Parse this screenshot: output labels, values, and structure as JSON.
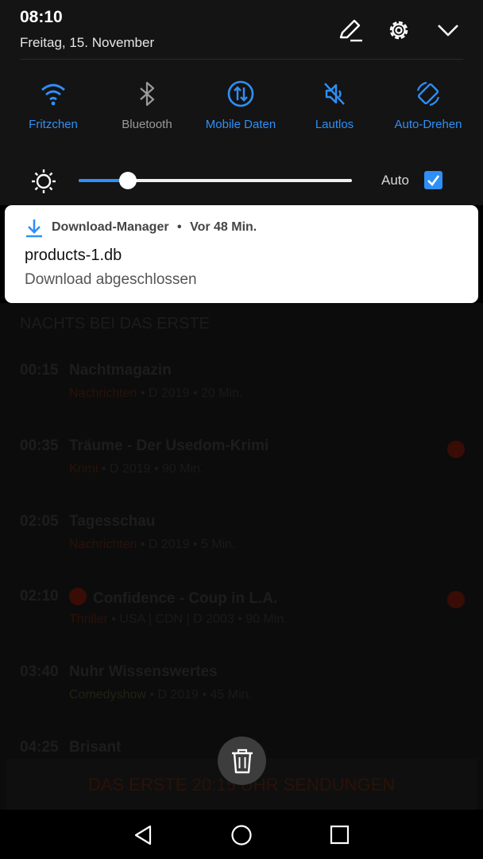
{
  "status": {
    "time": "08:10",
    "date": "Freitag, 15. November"
  },
  "quick_settings": [
    {
      "label": "Fritzchen",
      "icon": "wifi-icon",
      "active": true
    },
    {
      "label": "Bluetooth",
      "icon": "bluetooth-icon",
      "active": false
    },
    {
      "label": "Mobile Daten",
      "icon": "mobile-data-icon",
      "active": true
    },
    {
      "label": "Lautlos",
      "icon": "mute-icon",
      "active": true
    },
    {
      "label": "Auto-Drehen",
      "icon": "auto-rotate-icon",
      "active": true
    }
  ],
  "brightness": {
    "level_fraction": 0.18,
    "auto_label": "Auto",
    "auto_checked": true
  },
  "notification": {
    "app": "Download-Manager",
    "time_ago": "Vor 48 Min.",
    "separator": "•",
    "title": "products-1.db",
    "text": "Download abgeschlossen"
  },
  "background": {
    "section_title": "NACHTS BEI DAS ERSTE",
    "programs": [
      {
        "time": "00:15",
        "title": "Nachtmagazin",
        "genre": "Nachrichten",
        "meta": " • D 2019 • 20 Min.",
        "record": false,
        "play": false
      },
      {
        "time": "00:35",
        "title": "Träume - Der Usedom-Krimi",
        "genre": "Krimi",
        "meta": " • D 2019 • 90 Min.",
        "record": true,
        "play": false
      },
      {
        "time": "02:05",
        "title": "Tagesschau",
        "genre": "Nachrichten",
        "meta": " • D 2019 • 5 Min.",
        "record": false,
        "play": false
      },
      {
        "time": "02:10",
        "title": "Confidence - Coup in L.A.",
        "genre": "Thriller",
        "meta": " • USA | CDN | D 2003 • 90 Min.",
        "record": true,
        "play": true
      },
      {
        "time": "03:40",
        "title": "Nuhr Wissenswertes",
        "genre": "Comedyshow",
        "meta": " • D 2019 • 45 Min.",
        "record": false,
        "play": false
      },
      {
        "time": "04:25",
        "title": "Brisant",
        "genre": "",
        "meta": "",
        "record": false,
        "play": false
      }
    ],
    "banner": "DAS ERSTE 20:15 UHR SENDUNGEN"
  },
  "colors": {
    "accent": "#2f8ff7",
    "shade": "#141414",
    "card": "#ffffff"
  }
}
